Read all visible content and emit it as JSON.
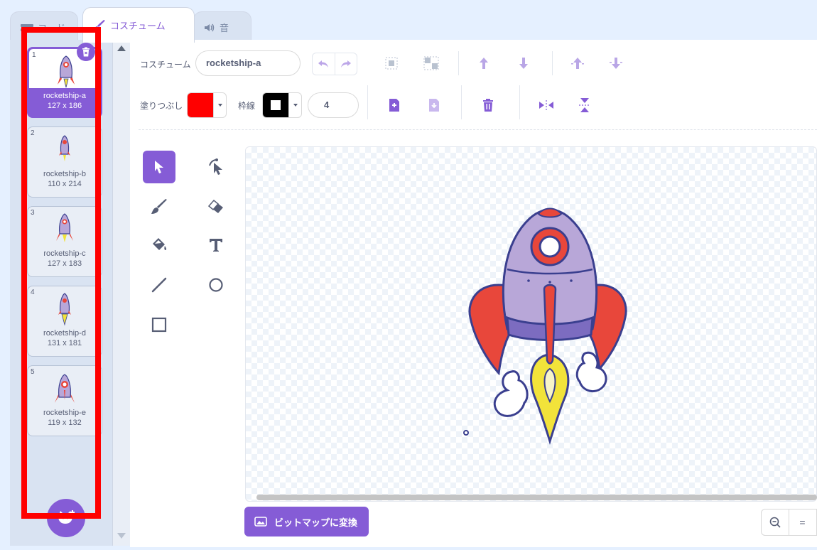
{
  "tabs": {
    "code": "コード",
    "costume": "コスチューム",
    "sound": "音"
  },
  "costumes": [
    {
      "index": "1",
      "name": "rocketship-a",
      "size": "127 x 186",
      "selected": true
    },
    {
      "index": "2",
      "name": "rocketship-b",
      "size": "110 x 214",
      "selected": false
    },
    {
      "index": "3",
      "name": "rocketship-c",
      "size": "127 x 183",
      "selected": false
    },
    {
      "index": "4",
      "name": "rocketship-d",
      "size": "131 x 181",
      "selected": false
    },
    {
      "index": "5",
      "name": "rocketship-e",
      "size": "119 x 132",
      "selected": false
    }
  ],
  "editor": {
    "costume_label": "コスチューム",
    "costume_name": "rocketship-a",
    "fill_label": "塗りつぶし",
    "outline_label": "枠線",
    "outline_width": "4",
    "convert_button": "ビットマップに変換",
    "zoom_reset": "="
  },
  "colors": {
    "accent": "#855cd6",
    "fill": "#ff0000",
    "outline": "#000000",
    "highlight": "#ff0000"
  }
}
